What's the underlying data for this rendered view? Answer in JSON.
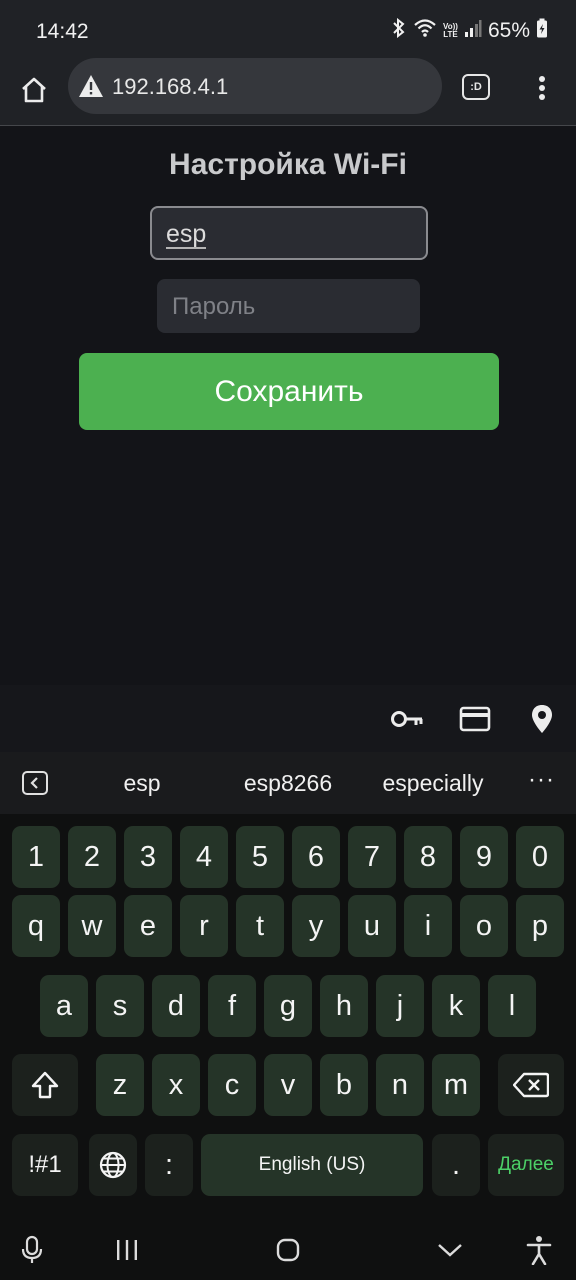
{
  "status_bar": {
    "time": "14:42",
    "battery_percent": "65%",
    "lte_line1": "Vo))",
    "lte_line2": "LTE",
    "icons": [
      "bluetooth-icon",
      "wifi-icon",
      "volte-lte-icon",
      "signal-icon",
      "battery-icon"
    ]
  },
  "browser": {
    "url": "192.168.4.1",
    "tab_label": ":D",
    "icons": [
      "home-icon",
      "warning-icon",
      "tab-switcher-icon",
      "more-vert-icon"
    ]
  },
  "page": {
    "title": "Настройка Wi-Fi",
    "ssid_value": "esp",
    "password_placeholder": "Пароль",
    "save_label": "Сохранить"
  },
  "autofill": {
    "icons": [
      "key-icon",
      "credit-card-icon",
      "location-pin-icon"
    ]
  },
  "suggestions": {
    "words": [
      "esp",
      "esp8266",
      "especially"
    ],
    "more": "···"
  },
  "keyboard": {
    "numbers": [
      "1",
      "2",
      "3",
      "4",
      "5",
      "6",
      "7",
      "8",
      "9",
      "0"
    ],
    "row1": [
      "q",
      "w",
      "e",
      "r",
      "t",
      "y",
      "u",
      "i",
      "o",
      "p"
    ],
    "row2": [
      "a",
      "s",
      "d",
      "f",
      "g",
      "h",
      "j",
      "k",
      "l"
    ],
    "row3": [
      "z",
      "x",
      "c",
      "v",
      "b",
      "n",
      "m"
    ],
    "symbols_label": "!#1",
    "comma_label": ":",
    "space_label": "English (US)",
    "period_label": ".",
    "done_label": "Далее"
  },
  "colors": {
    "accent_green": "#4cb050",
    "key_bg": "#253428",
    "done_green": "#4cd067"
  }
}
